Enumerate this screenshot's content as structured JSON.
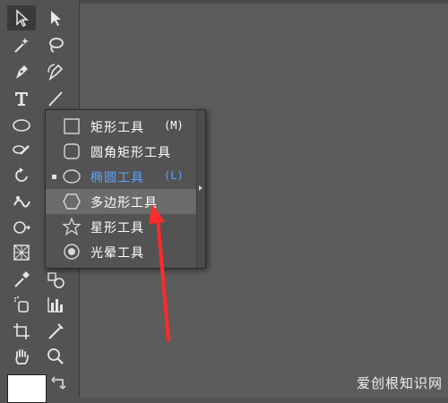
{
  "flyout": {
    "items": [
      {
        "label": "矩形工具",
        "shortcut": "(M)",
        "icon": "rectangle-icon"
      },
      {
        "label": "圆角矩形工具",
        "shortcut": "",
        "icon": "rounded-rectangle-icon"
      },
      {
        "label": "椭圆工具",
        "shortcut": "(L)",
        "icon": "ellipse-icon"
      },
      {
        "label": "多边形工具",
        "shortcut": "",
        "icon": "polygon-icon"
      },
      {
        "label": "星形工具",
        "shortcut": "",
        "icon": "star-icon"
      },
      {
        "label": "光晕工具",
        "shortcut": "",
        "icon": "flare-icon"
      }
    ]
  },
  "toolbar": {
    "tools": [
      "selection-icon",
      "direct-selection-icon",
      "magic-wand-icon",
      "lasso-icon",
      "pen-icon",
      "curvature-icon",
      "type-icon",
      "line-segment-icon",
      "ellipse-tool-icon",
      "paintbrush-icon",
      "rotate-icon",
      "width-icon",
      "shape-builder-icon",
      "free-transform-icon",
      "perspective-grid-icon",
      "mesh-icon",
      "eyedropper-icon",
      "blend-icon",
      "symbol-sprayer-icon",
      "column-graph-icon",
      "artboard-icon",
      "slice-icon",
      "hand-icon",
      "zoom-icon"
    ]
  },
  "watermark": "爱创根知识网",
  "colors": {
    "accent": "#5aa3ff",
    "arrow": "#ff2a2a",
    "panel": "#535353"
  }
}
